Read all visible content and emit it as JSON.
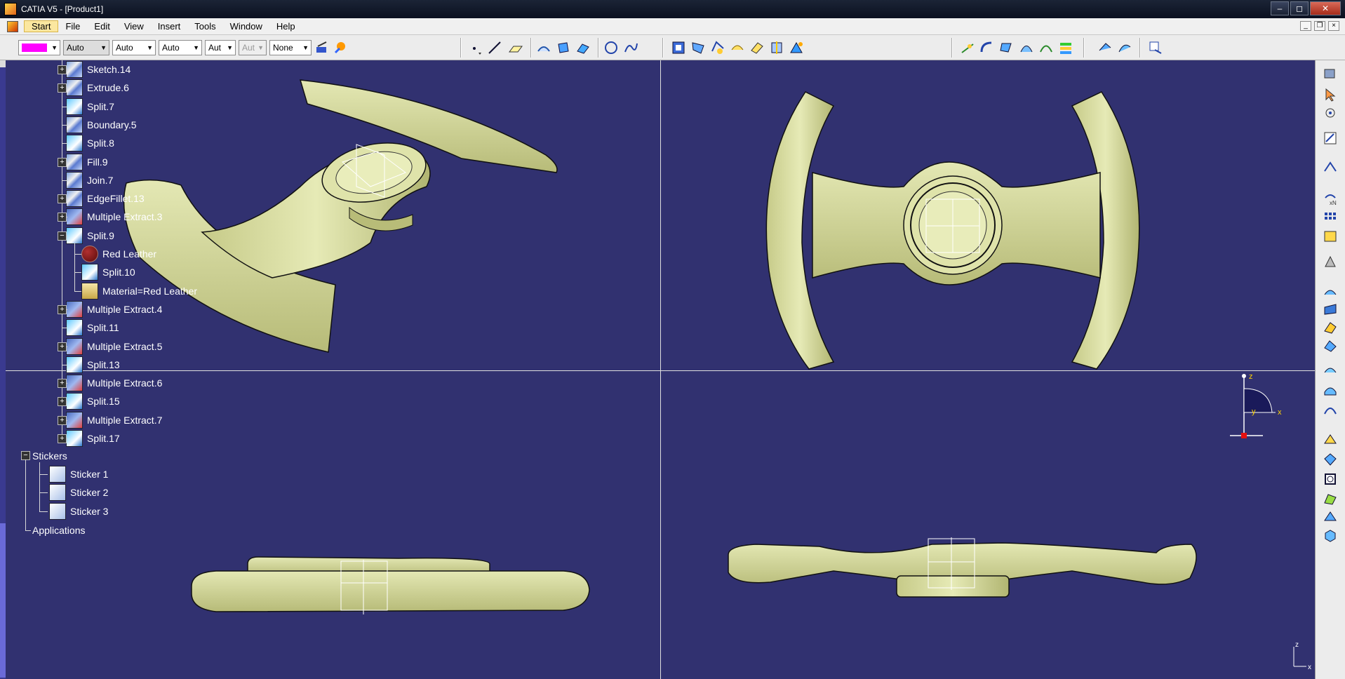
{
  "window": {
    "title": "CATIA V5 - [Product1]"
  },
  "menu": [
    "Start",
    "File",
    "Edit",
    "View",
    "Insert",
    "Tools",
    "Window",
    "Help"
  ],
  "toolbar": {
    "color_value": "#ff00ff",
    "line_type_1": "Auto",
    "line_type_2": "Auto",
    "line_type_3": "Auto",
    "line_weight": "Aut",
    "layer_disabled": "Aut",
    "layer": "None"
  },
  "tree": {
    "items": [
      {
        "label": "Sketch.14",
        "icon": "sketch-icon"
      },
      {
        "label": "Extrude.6",
        "icon": "extrude-icon"
      },
      {
        "label": "Split.7",
        "icon": "split-icon"
      },
      {
        "label": "Boundary.5",
        "icon": "boundary-icon"
      },
      {
        "label": "Split.8",
        "icon": "split-icon"
      },
      {
        "label": "Fill.9",
        "icon": "fill-icon"
      },
      {
        "label": "Join.7",
        "icon": "join-icon"
      },
      {
        "label": "EdgeFillet.13",
        "icon": "edge-fillet-icon"
      },
      {
        "label": "Multiple Extract.3",
        "icon": "extract-icon"
      },
      {
        "label": "Split.9",
        "icon": "split-icon"
      },
      {
        "label": "Red Leather",
        "icon": "material-sphere-icon"
      },
      {
        "label": "Split.10",
        "icon": "split-icon"
      },
      {
        "label": "Material=Red Leather",
        "icon": "material-icon"
      },
      {
        "label": "Multiple Extract.4",
        "icon": "extract-icon"
      },
      {
        "label": "Split.11",
        "icon": "split-icon"
      },
      {
        "label": "Multiple Extract.5",
        "icon": "extract-icon"
      },
      {
        "label": "Split.13",
        "icon": "split-icon"
      },
      {
        "label": "Multiple Extract.6",
        "icon": "extract-icon"
      },
      {
        "label": "Split.15",
        "icon": "split-icon"
      },
      {
        "label": "Multiple Extract.7",
        "icon": "extract-icon"
      },
      {
        "label": "Split.17",
        "icon": "split-icon"
      }
    ],
    "stickers_label": "Stickers",
    "stickers": [
      "Sticker 1",
      "Sticker 2",
      "Sticker 3"
    ],
    "applications_label": "Applications"
  },
  "compass": {
    "z": "z",
    "y": "y",
    "x": "x"
  },
  "axis_corner": {
    "z": "z",
    "x": "x"
  },
  "colors": {
    "background": "#313170",
    "part": "#d7dc9e",
    "part_shade": "#b8bc7a",
    "selection": "#ff00ff"
  }
}
